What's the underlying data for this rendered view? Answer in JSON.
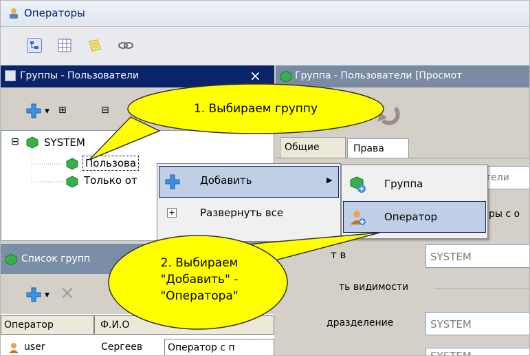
{
  "window": {
    "title": "Операторы"
  },
  "colors": {
    "accent": "#0a246a",
    "callout": "#ffff00",
    "menu_selected": "#c1cfe6"
  },
  "toolbar": {
    "icons": [
      "tree-icon",
      "grid-icon",
      "note-icon",
      "link-icon"
    ]
  },
  "groups_panel": {
    "title": "Группы - Пользователи",
    "close_glyph": "×",
    "expand_glyph": "⊞",
    "collapse_glyph": "⊟",
    "tree": {
      "root": {
        "label": "SYSTEM",
        "toggle": "⊟"
      },
      "children": [
        {
          "label": "Пользова"
        },
        {
          "label": "Только от"
        }
      ]
    }
  },
  "group_panel": {
    "title": "Группа - Пользователи [Просмот",
    "tabs": [
      "Общие",
      "Права"
    ],
    "fields": {
      "visible_prefix": "тели",
      "rights_prefix": "ры с о",
      "member_label": "т в",
      "member_value": "SYSTEM",
      "visibility_label": "ть видимости",
      "division_label": "дразделение",
      "division_value": "SYSTEM",
      "bottom_value": "SYSTEM"
    }
  },
  "list_panel": {
    "title": "Список групп",
    "columns": [
      "Оператор",
      "Ф.И.О"
    ],
    "rows": [
      {
        "operator": "user",
        "name": "Сергеев",
        "desc": "Оператор с п"
      }
    ]
  },
  "context_menu": {
    "items": [
      {
        "label": "Добавить",
        "icon": "plus-icon",
        "submenu_arrow": "▶"
      },
      {
        "label": "Развернуть все",
        "icon": "expand-icon"
      }
    ]
  },
  "submenu": {
    "items": [
      {
        "label": "Группа",
        "icon": "add-group-icon"
      },
      {
        "label": "Оператор",
        "icon": "add-operator-icon"
      }
    ]
  },
  "callouts": [
    {
      "text": "1. Выбираем группу"
    },
    {
      "lines": [
        "2. Выбираем",
        "\"Добавить\" -",
        "\"Оператора\""
      ]
    }
  ]
}
